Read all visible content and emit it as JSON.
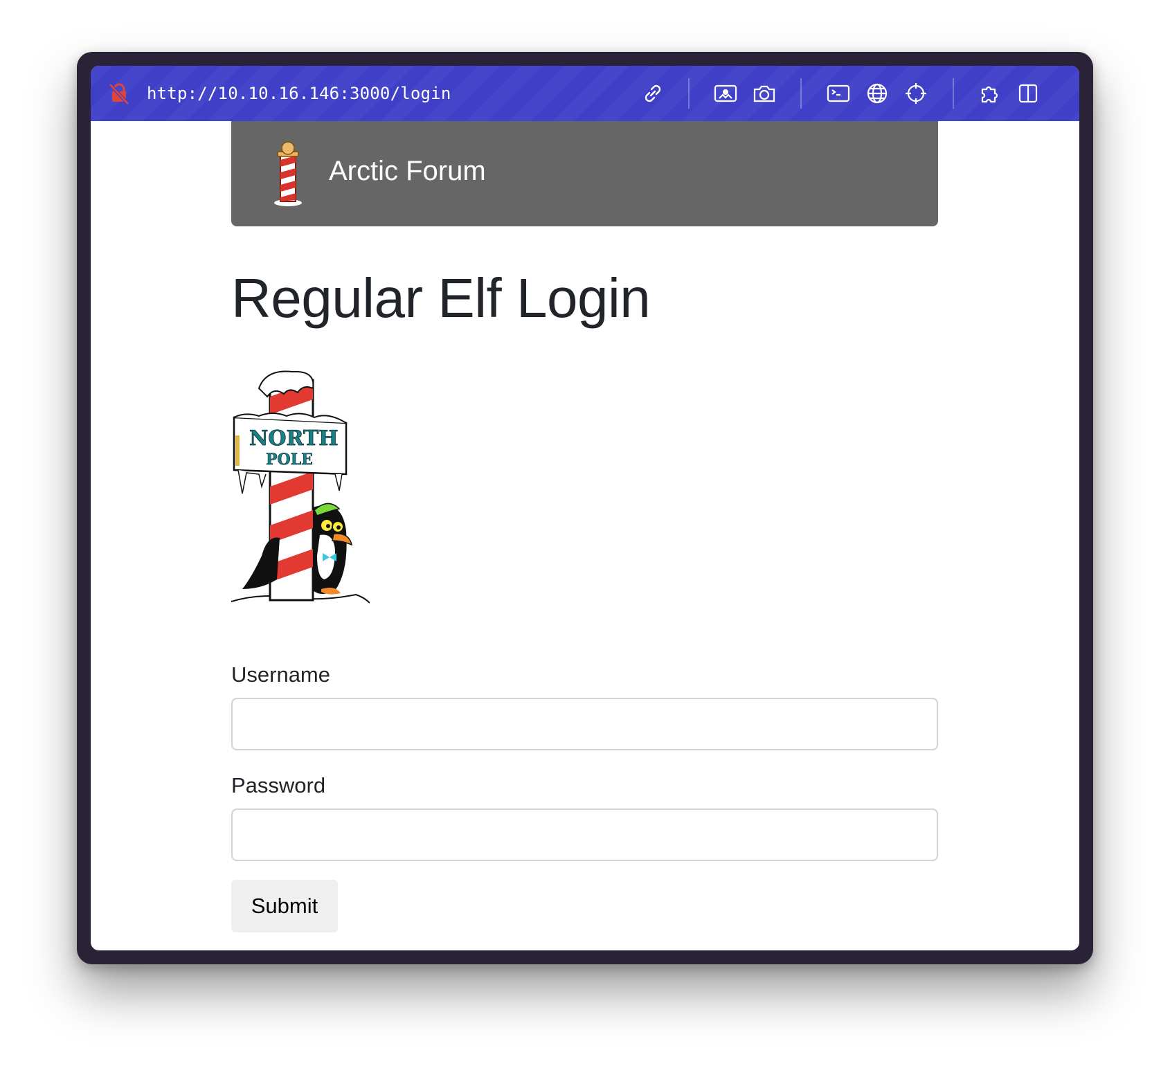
{
  "browser": {
    "url": "http://10.10.16.146:3000/login",
    "toolbar_icons": [
      "insecure-lock-icon",
      "link-icon",
      "image-icon",
      "camera-icon",
      "terminal-icon",
      "globe-icon",
      "crosshair-icon",
      "extension-icon",
      "split-view-icon"
    ],
    "accent_color": "#3f3fc8",
    "insecure_color": "#e0453a"
  },
  "navbar": {
    "brand": "Arctic Forum",
    "logo": "north-pole-logo",
    "background": "#666666"
  },
  "main": {
    "title": "Regular Elf Login",
    "hero_image": "north-pole-penguin-image",
    "hero_sign_text": [
      "NORTH",
      "POLE"
    ],
    "form": {
      "username_label": "Username",
      "username_value": "",
      "password_label": "Password",
      "password_value": "",
      "submit_label": "Submit"
    }
  }
}
